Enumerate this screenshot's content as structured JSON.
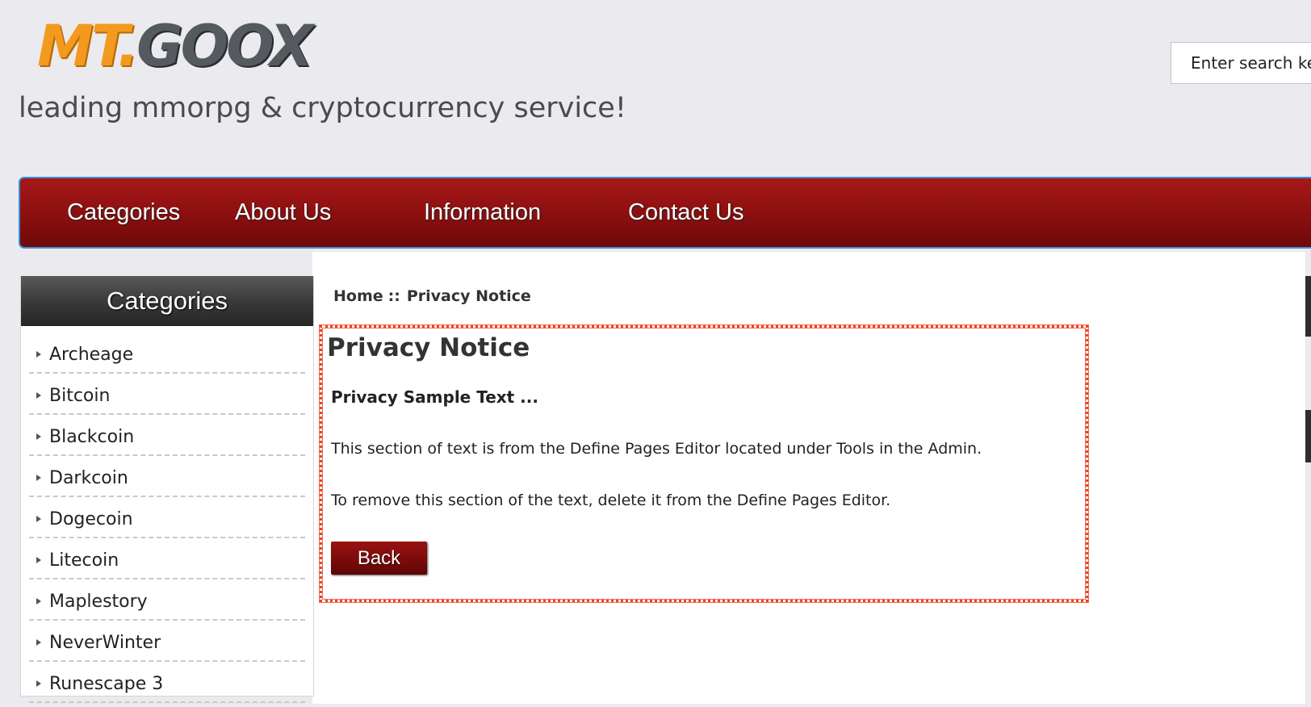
{
  "header": {
    "logo_text_mt": "MT.",
    "logo_text_goox": "GOOX",
    "tagline": "leading mmorpg & cryptocurrency service!",
    "search": {
      "placeholder": "Enter search keywords here"
    }
  },
  "nav": {
    "items": [
      {
        "label": "Categories"
      },
      {
        "label": "About Us"
      },
      {
        "label": "Information"
      },
      {
        "label": "Contact Us"
      }
    ]
  },
  "sidebar": {
    "heading": "Categories",
    "items": [
      {
        "label": "Archeage"
      },
      {
        "label": "Bitcoin"
      },
      {
        "label": "Blackcoin"
      },
      {
        "label": "Darkcoin"
      },
      {
        "label": "Dogecoin"
      },
      {
        "label": "Litecoin"
      },
      {
        "label": "Maplestory"
      },
      {
        "label": "NeverWinter"
      },
      {
        "label": "Runescape 3"
      }
    ]
  },
  "breadcrumb": {
    "home": "Home",
    "separator": "::",
    "current": "Privacy Notice"
  },
  "main": {
    "title": "Privacy Notice",
    "subtitle": "Privacy Sample Text ...",
    "paragraphs": [
      "This section of text is from the Define Pages Editor located under Tools in the Admin.",
      "To remove this section of the text, delete it from the Define Pages Editor."
    ],
    "back_label": "Back"
  },
  "colors": {
    "page_background": "#ebebef",
    "nav_red": "#8d1010",
    "logo_orange": "#f39a1e",
    "logo_gray": "#555a5e",
    "highlight_border": "#f0401f"
  }
}
